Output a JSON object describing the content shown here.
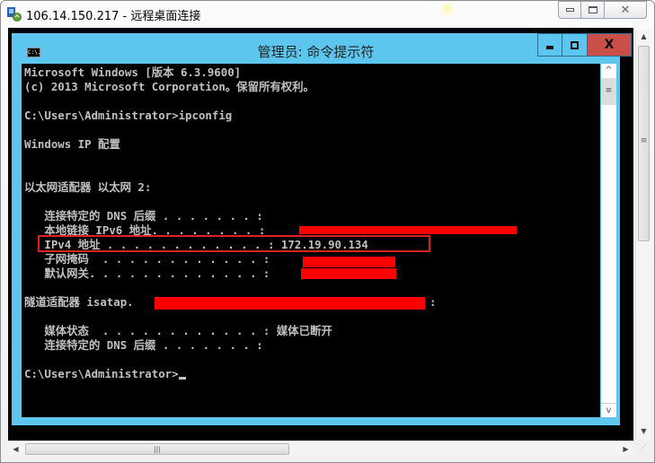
{
  "rdp_window": {
    "title": "106.14.150.217 - 远程桌面连接",
    "icon": "remote-desktop-icon",
    "controls": {
      "minimize": "minimize-icon",
      "maximize": "restore-icon",
      "close": "✕"
    }
  },
  "cmd_window": {
    "title": "管理员: 命令提示符",
    "icon_text": "C:\\.",
    "controls": {
      "minimize": "minimize-icon",
      "maximize": "maximize-icon",
      "close": "X"
    }
  },
  "console": {
    "lines": [
      "Microsoft Windows [版本 6.3.9600]",
      "(c) 2013 Microsoft Corporation。保留所有权利。",
      "",
      "C:\\Users\\Administrator>ipconfig",
      "",
      "Windows IP 配置",
      "",
      "",
      "以太网适配器 以太网 2:",
      "",
      "   连接特定的 DNS 后缀 . . . . . . . :",
      "   本地链接 IPv6 地址. . . . . . . . :",
      "   IPv4 地址 . . . . . . . . . . . . : 172.19.90.134",
      "   子网掩码  . . . . . . . . . . . . :",
      "   默认网关. . . . . . . . . . . . . :",
      "",
      "隧道适配器 isatap.",
      "",
      "   媒体状态  . . . . . . . . . . . . : 媒体已断开",
      "   连接特定的 DNS 后缀 . . . . . . . :",
      "",
      "C:\\Users\\Administrator>"
    ],
    "isatap_suffix": ":",
    "highlighted_field": "IPv4 地址",
    "ipv4_address": "172.19.90.134",
    "redacted_fields": [
      "本地链接 IPv6 地址",
      "子网掩码",
      "默认网关",
      "isatap adapter name"
    ]
  },
  "colors": {
    "cmd_frame": "#5dc6ee",
    "cmd_close": "#c9504a",
    "console_bg": "#000000",
    "console_text": "#c0c0c0",
    "redaction": "#ff0000",
    "highlight_box": "#dd2222"
  },
  "scrollbars": {
    "vertical_arrows": [
      "▲",
      "▼"
    ],
    "horizontal_arrows": [
      "◀",
      "▶"
    ],
    "grip": "⋰",
    "cmd_up": "^",
    "cmd_down": "v"
  }
}
